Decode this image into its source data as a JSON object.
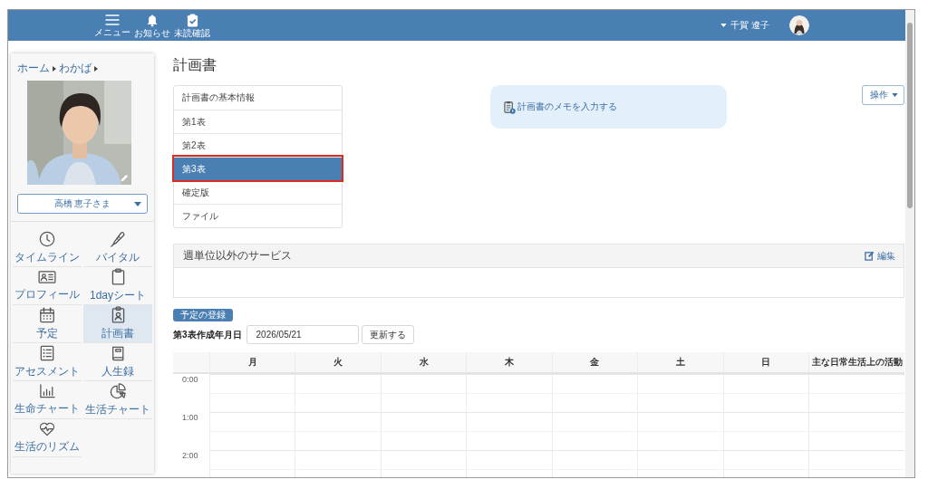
{
  "topbar": {
    "items": [
      {
        "label": "メニュー",
        "kind": "menu"
      },
      {
        "label": "お知らせ",
        "kind": "bell"
      },
      {
        "label": "未読確認",
        "kind": "check"
      }
    ],
    "user": {
      "name": "千賀 遼子"
    }
  },
  "sidebar": {
    "breadcrumb": [
      "ホーム",
      "わかば"
    ],
    "resident": {
      "name": "高橋 恵子さま"
    },
    "items": [
      {
        "label": "タイムライン",
        "selected": false
      },
      {
        "label": "バイタル",
        "selected": false
      },
      {
        "label": "プロフィール",
        "selected": false
      },
      {
        "label": "1dayシート",
        "selected": false
      },
      {
        "label": "予定",
        "selected": false
      },
      {
        "label": "計画書",
        "selected": true
      },
      {
        "label": "アセスメント",
        "selected": false
      },
      {
        "label": "人生録",
        "selected": false
      },
      {
        "label": "生命チャート",
        "selected": false
      },
      {
        "label": "生活チャート",
        "selected": false
      },
      {
        "label": "生活のリズム",
        "selected": false
      }
    ]
  },
  "page": {
    "title": "計画書",
    "nav": [
      {
        "label": "計画書の基本情報",
        "selected": false,
        "highlighted": false
      },
      {
        "label": "第1表",
        "selected": false,
        "highlighted": false
      },
      {
        "label": "第2表",
        "selected": false,
        "highlighted": false
      },
      {
        "label": "第3表",
        "selected": true,
        "highlighted": true
      },
      {
        "label": "確定版",
        "selected": false,
        "highlighted": false
      },
      {
        "label": "ファイル",
        "selected": false,
        "highlighted": false
      }
    ],
    "memo": {
      "label": "計画書のメモを入力する"
    },
    "actions_button": "操作",
    "services": {
      "title": "週単位以外のサービス",
      "edit": "編集"
    },
    "register_button": "予定の登録",
    "date": {
      "label": "第3表作成年月日",
      "value": "2026/05/21",
      "update_button": "更新する"
    },
    "schedule": {
      "columns": [
        "月",
        "火",
        "水",
        "木",
        "金",
        "土",
        "日",
        "主な日常生活上の活動"
      ],
      "times": [
        "0:00",
        "1:00",
        "2:00"
      ]
    }
  }
}
